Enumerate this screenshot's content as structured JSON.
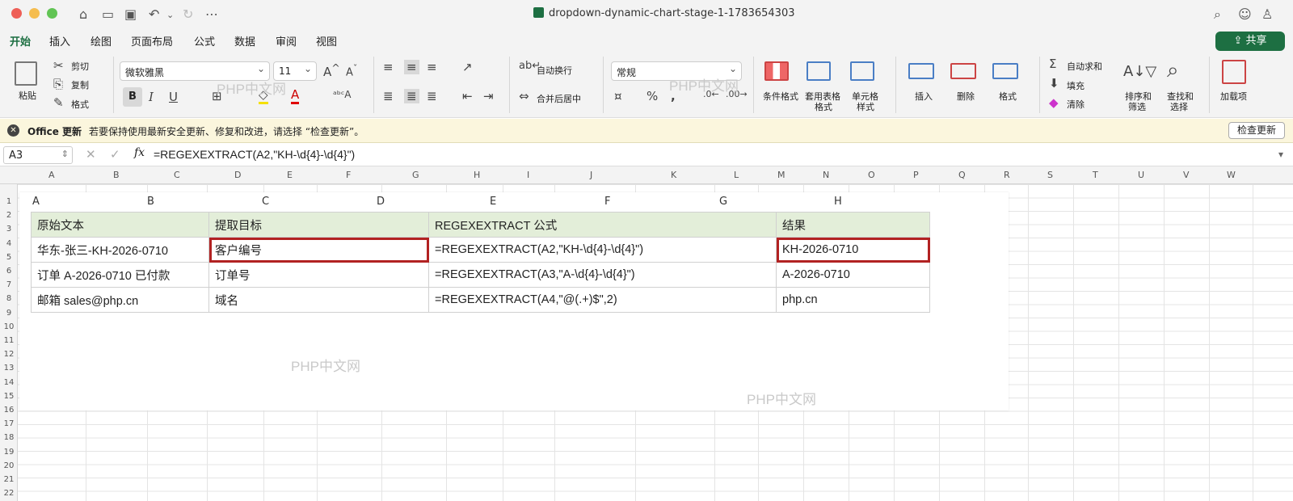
{
  "window": {
    "title": "dropdown-dynamic-chart-stage-1-1783654303"
  },
  "titlebar": {
    "colors": {
      "close": "#ee5f57",
      "minimize": "#f5bd4f",
      "zoom": "#61c454"
    }
  },
  "menu": {
    "tabs": [
      "开始",
      "插入",
      "绘图",
      "页面布局",
      "公式",
      "数据",
      "审阅",
      "视图"
    ],
    "active_tab": "开始",
    "share_label": "共享"
  },
  "ribbon": {
    "paste": "粘贴",
    "cut": "剪切",
    "copy": "复制",
    "format_painter": "格式",
    "font_name": "微软雅黑",
    "font_size": "11",
    "wrap_text": "自动换行",
    "merge_center": "合并后居中",
    "number_format": "常规",
    "conditional_format": "条件格式",
    "table_format_1": "套用表格",
    "table_format_2": "格式",
    "cell_style_1": "单元格",
    "cell_style_2": "样式",
    "insert": "插入",
    "delete": "删除",
    "format": "格式",
    "autosum": "自动求和",
    "fill": "填充",
    "clear": "清除",
    "sort_1": "排序和",
    "sort_2": "筛选",
    "find_1": "查找和",
    "find_2": "选择",
    "addins": "加载项"
  },
  "update_bar": {
    "title": "Office 更新",
    "message": "若要保持使用最新安全更新、修复和改进，请选择 “检查更新”。",
    "button": "检查更新"
  },
  "formula_bar": {
    "name_box": "A3",
    "formula": "=REGEXEXTRACT(A2,\"KH-\\d{4}-\\d{4}\")"
  },
  "sheet": {
    "column_headers": [
      "A",
      "B",
      "C",
      "D",
      "E",
      "F",
      "G",
      "H",
      "I",
      "J",
      "K",
      "L",
      "M",
      "N",
      "O",
      "P",
      "Q",
      "R",
      "S",
      "T",
      "U",
      "V",
      "W"
    ],
    "row_headers": [
      "1",
      "2",
      "3",
      "4",
      "5",
      "6",
      "7",
      "8",
      "9",
      "10",
      "11",
      "12",
      "13",
      "14",
      "15",
      "16",
      "17",
      "18",
      "19",
      "20",
      "21",
      "22"
    ]
  },
  "picture": {
    "column_headers": [
      "A",
      "B",
      "C",
      "D",
      "E",
      "F",
      "G",
      "H"
    ],
    "table": {
      "header": [
        "原始文本",
        "提取目标",
        "REGEXEXTRACT 公式",
        "结果"
      ],
      "rows": [
        [
          "华东-张三-KH-2026-0710",
          "客户编号",
          "=REGEXEXTRACT(A2,\"KH-\\d{4}-\\d{4}\")",
          "KH-2026-0710"
        ],
        [
          "订单 A-2026-0710 已付款",
          "订单号",
          "=REGEXEXTRACT(A3,\"A-\\d{4}-\\d{4}\")",
          "A-2026-0710"
        ],
        [
          "邮箱 sales@php.cn",
          "域名",
          "=REGEXEXTRACT(A4,\"@(.+)$\",2)",
          "php.cn"
        ]
      ],
      "highlight_color": "#b22222",
      "header_fill": "#e3eed9"
    },
    "watermark": "PHP中文网"
  },
  "theme": {
    "accent": "#1d6f42"
  }
}
